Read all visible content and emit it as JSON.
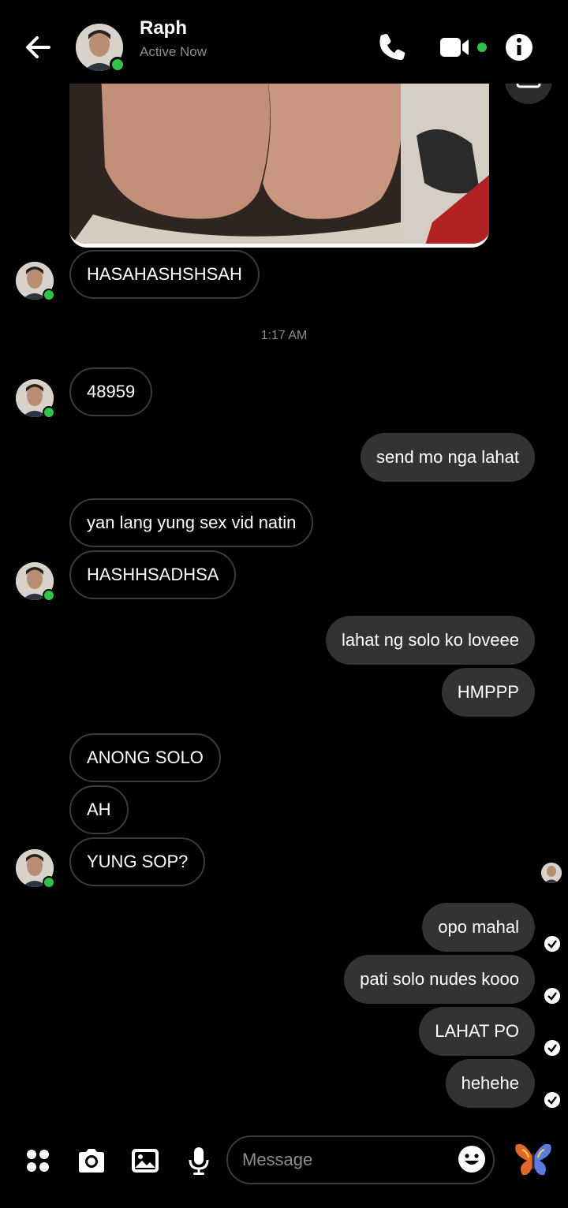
{
  "header": {
    "name": "Raph",
    "status": "Active Now",
    "accent": "#31c24a"
  },
  "timestamp": "1:17 AM",
  "messages": [
    {
      "text": "HASAHASHSHSAH",
      "from": "them"
    },
    {
      "text": "48959",
      "from": "them"
    },
    {
      "text": "send mo nga lahat",
      "from": "me"
    },
    {
      "text": "yan lang yung sex vid natin",
      "from": "them"
    },
    {
      "text": "HASHHSADHSA",
      "from": "them"
    },
    {
      "text": "lahat ng solo ko loveee",
      "from": "me"
    },
    {
      "text": "HMPPP",
      "from": "me"
    },
    {
      "text": "ANONG SOLO",
      "from": "them"
    },
    {
      "text": "AH",
      "from": "them"
    },
    {
      "text": "YUNG SOP?",
      "from": "them"
    },
    {
      "text": "opo mahal",
      "from": "me"
    },
    {
      "text": "pati solo nudes kooo",
      "from": "me"
    },
    {
      "text": "LAHAT PO",
      "from": "me"
    },
    {
      "text": "hehehe",
      "from": "me"
    }
  ],
  "composer": {
    "placeholder": "Message"
  },
  "icons": {
    "back": "arrow-left-icon",
    "call": "phone-icon",
    "video": "video-camera-icon",
    "info": "info-icon",
    "more": "apps-grid-icon",
    "camera": "camera-icon",
    "gallery": "gallery-icon",
    "mic": "microphone-icon",
    "emoji": "emoji-icon",
    "like": "butterfly-icon"
  }
}
